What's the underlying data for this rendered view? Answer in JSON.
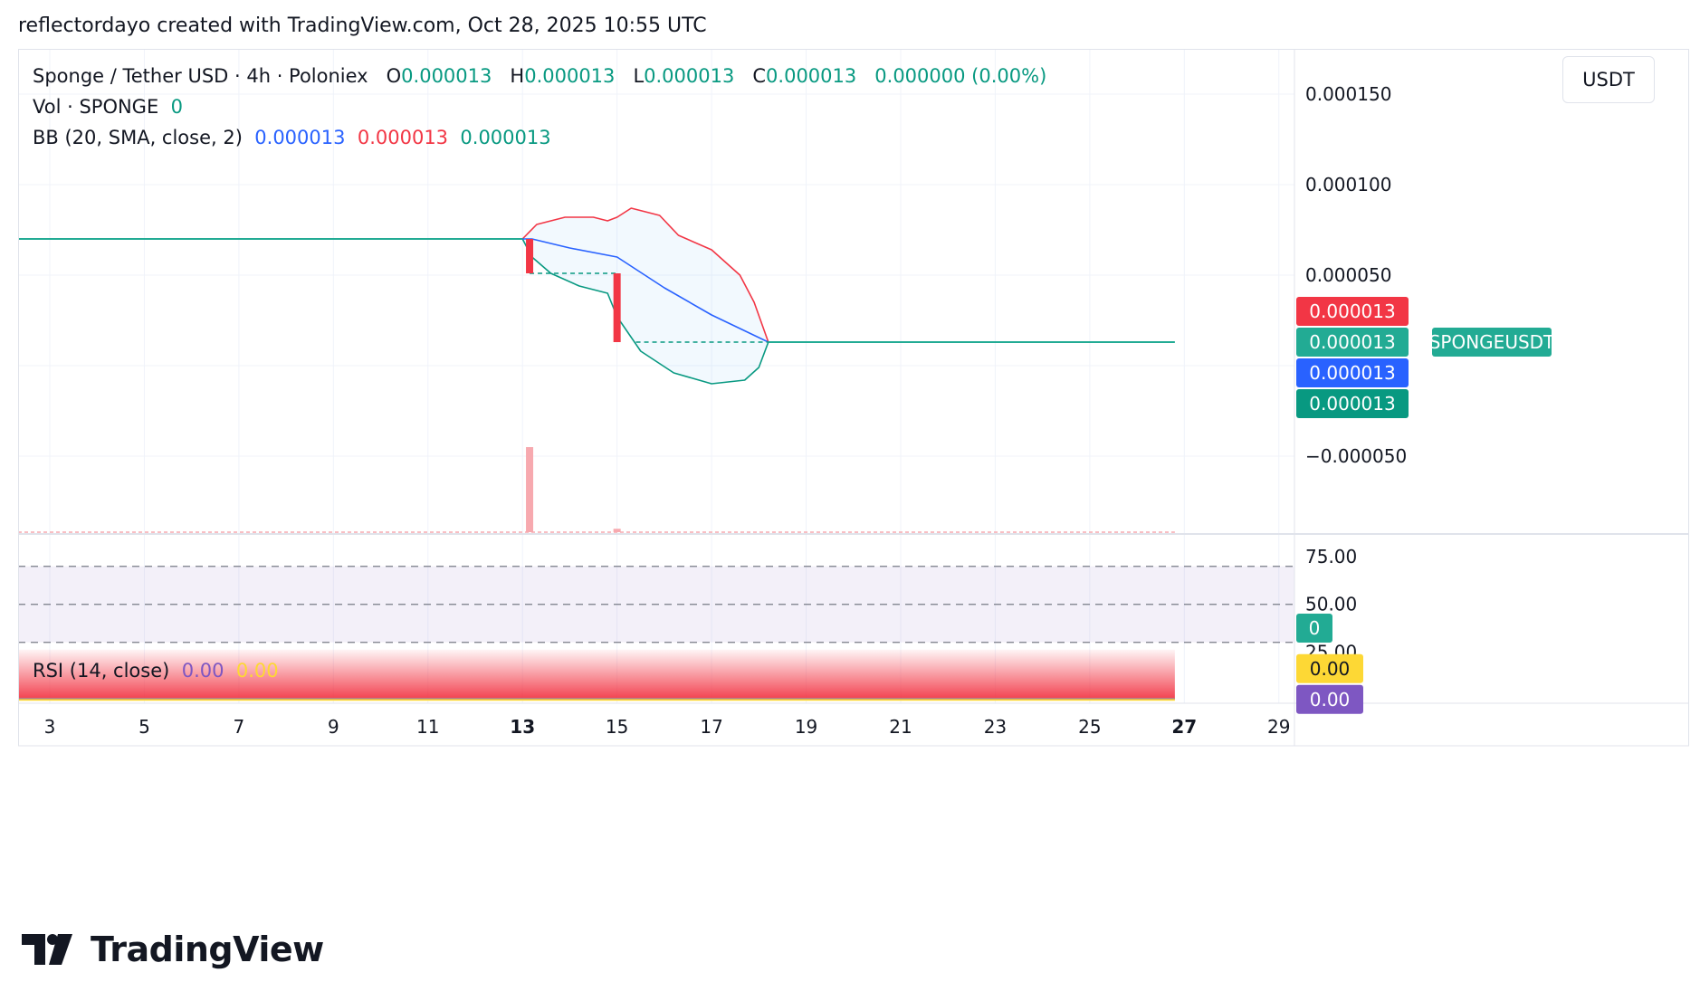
{
  "caption": "reflectordayo created with TradingView.com, Oct 28, 2025 10:55 UTC",
  "legend": {
    "symbol": "Sponge / Tether USD · 4h · Poloniex",
    "o_label": "O",
    "o_value": "0.000013",
    "h_label": "H",
    "h_value": "0.000013",
    "l_label": "L",
    "l_value": "0.000013",
    "c_label": "C",
    "c_value": "0.000013",
    "change": "0.000000 (0.00%)",
    "vol_label": "Vol · SPONGE",
    "vol_value": "0",
    "bb_label": "BB (20, SMA, close, 2)",
    "bb_basis": "0.000013",
    "bb_upper": "0.000013",
    "bb_lower": "0.000013",
    "rsi_label": "RSI (14, close)",
    "rsi_value": "0.00",
    "rsi_ma": "0.00"
  },
  "price_axis": {
    "unit": "USDT"
  },
  "badges": {
    "symbol_tag": "SPONGEUSDT",
    "upper": "0.000013",
    "last": "0.000013",
    "basis": "0.000013",
    "lower": "0.000013",
    "volume": "0",
    "rsi_ma": "0.00",
    "rsi": "0.00"
  },
  "colors": {
    "up": "#089981",
    "down": "#f23645",
    "bb_basis": "#2962ff",
    "bb_upper": "#f23645",
    "bb_lower": "#089981",
    "price_line": "#22ab94",
    "rsi": "#7e57c2",
    "rsi_ma": "#fdd835",
    "grid": "#f0f3fa",
    "text": "#131722"
  },
  "chart_data": [
    {
      "type": "line",
      "title": "Sponge / Tether USD · 4h · Poloniex",
      "x_ticks": [
        {
          "day": 3,
          "label": "3"
        },
        {
          "day": 5,
          "label": "5"
        },
        {
          "day": 7,
          "label": "7"
        },
        {
          "day": 9,
          "label": "9"
        },
        {
          "day": 11,
          "label": "11"
        },
        {
          "day": 13,
          "label": "13",
          "bold": true
        },
        {
          "day": 15,
          "label": "15"
        },
        {
          "day": 17,
          "label": "17"
        },
        {
          "day": 19,
          "label": "19"
        },
        {
          "day": 21,
          "label": "21"
        },
        {
          "day": 23,
          "label": "23"
        },
        {
          "day": 25,
          "label": "25"
        },
        {
          "day": 27,
          "label": "27",
          "bold": true
        },
        {
          "day": 29,
          "label": "29"
        }
      ],
      "x_range": [
        2.33,
        29.33
      ],
      "y_range": [
        -9.3e-05,
        0.000175
      ],
      "y_ticks": [
        {
          "value": 0.00015,
          "label": "0.000150"
        },
        {
          "value": 0.0001,
          "label": "0.000100"
        },
        {
          "value": 5e-05,
          "label": "0.000050"
        },
        {
          "value": -5e-05,
          "label": "−0.000050"
        }
      ],
      "series": [
        {
          "name": "Sponge / Tether USD",
          "x": [
            2.33,
            13.0,
            13.15,
            15.0,
            15.4,
            18.2,
            26.8
          ],
          "y": [
            7e-05,
            7e-05,
            5.1e-05,
            5.1e-05,
            1.3e-05,
            1.3e-05,
            1.3e-05
          ]
        },
        {
          "name": "BB basis",
          "x": [
            13.0,
            13.2,
            14.0,
            15.0,
            16.0,
            17.0,
            18.2
          ],
          "y": [
            7e-05,
            7e-05,
            6.5e-05,
            6e-05,
            4.3e-05,
            2.8e-05,
            1.3e-05
          ]
        },
        {
          "name": "BB upper",
          "x": [
            13.0,
            13.3,
            13.9,
            14.5,
            14.8,
            15.0,
            15.3,
            15.9,
            16.3,
            17.0,
            17.6,
            17.9,
            18.2
          ],
          "y": [
            7e-05,
            7.8e-05,
            8.2e-05,
            8.2e-05,
            8e-05,
            8.2e-05,
            8.7e-05,
            8.3e-05,
            7.2e-05,
            6.4e-05,
            5e-05,
            3.5e-05,
            1.3e-05
          ]
        },
        {
          "name": "BB lower",
          "x": [
            13.0,
            13.2,
            13.6,
            14.2,
            14.8,
            15.0,
            15.5,
            16.2,
            17.0,
            17.7,
            18.0,
            18.2
          ],
          "y": [
            7e-05,
            6e-05,
            5.1e-05,
            4.4e-05,
            4e-05,
            2.7e-05,
            8e-06,
            -4e-06,
            -1e-05,
            -8e-06,
            -1e-06,
            1.3e-05
          ]
        }
      ],
      "candles": [
        {
          "day": 13.15,
          "open": 7e-05,
          "high": 7e-05,
          "low": 5.1e-05,
          "close": 5.1e-05
        },
        {
          "day": 15.0,
          "open": 5.1e-05,
          "high": 5.1e-05,
          "low": 1.3e-05,
          "close": 1.3e-05
        }
      ]
    },
    {
      "type": "bar",
      "title": "Vol · SPONGE",
      "x": [
        13.15,
        15.0
      ],
      "values": [
        100,
        4
      ],
      "y_range": [
        0,
        100
      ]
    },
    {
      "type": "line",
      "title": "RSI (14, close)",
      "y_range": [
        -2,
        87
      ],
      "y_ticks": [
        {
          "value": 75,
          "label": "75.00"
        },
        {
          "value": 50,
          "label": "50.00"
        },
        {
          "value": 25,
          "label": "25.00"
        }
      ],
      "band": [
        30,
        70
      ],
      "series": [
        {
          "name": "RSI",
          "x": [
            2.33,
            26.8
          ],
          "y": [
            0,
            0
          ]
        },
        {
          "name": "RSI-based MA",
          "x": [
            2.33,
            26.8
          ],
          "y": [
            0,
            0
          ]
        }
      ]
    }
  ]
}
